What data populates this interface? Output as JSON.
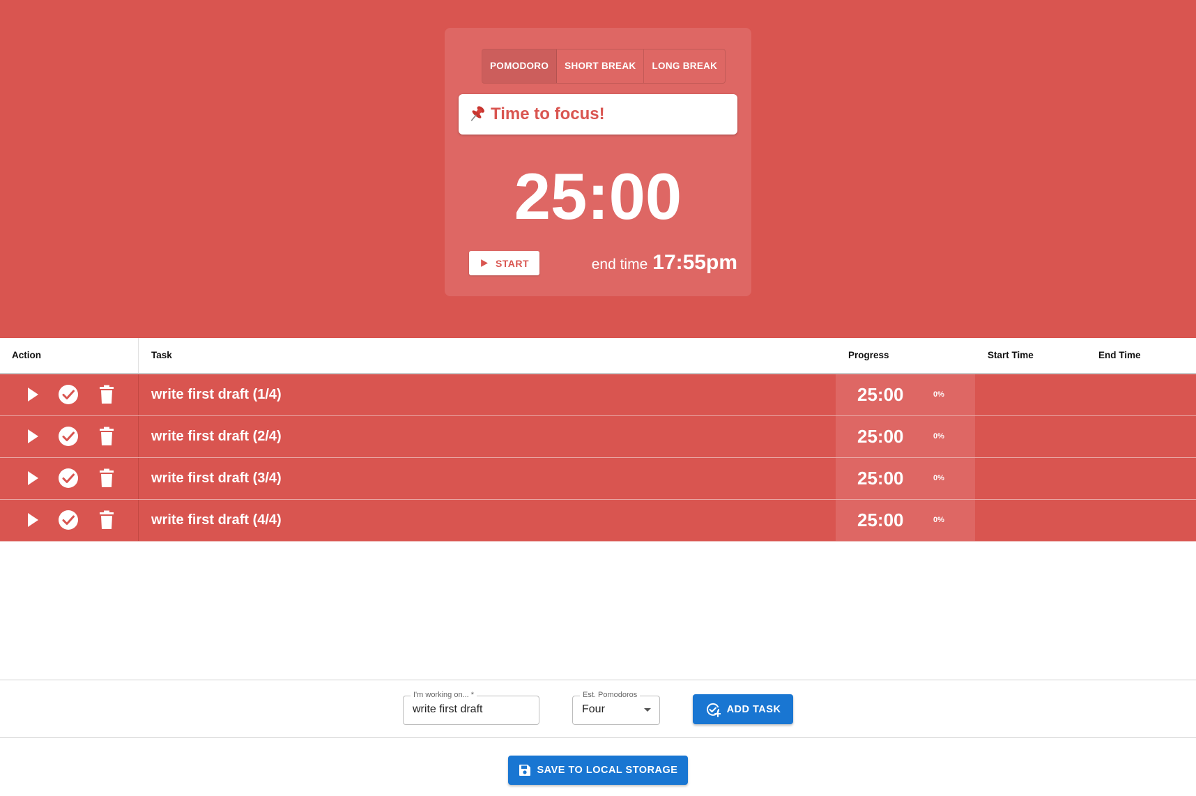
{
  "timer_card": {
    "modes": [
      {
        "label": "POMODORO",
        "active": true
      },
      {
        "label": "SHORT BREAK",
        "active": false
      },
      {
        "label": "LONG BREAK",
        "active": false
      }
    ],
    "focus_message": "Time to focus!",
    "time": "25:00",
    "start_label": "START",
    "end_time_label": "end time",
    "end_time_value": "17:55pm"
  },
  "table": {
    "headers": {
      "action": "Action",
      "task": "Task",
      "progress": "Progress",
      "start_time": "Start Time",
      "end_time": "End Time"
    },
    "rows": [
      {
        "task": "write first draft (1/4)",
        "time": "25:00",
        "percent": "0%"
      },
      {
        "task": "write first draft (2/4)",
        "time": "25:00",
        "percent": "0%"
      },
      {
        "task": "write first draft (3/4)",
        "time": "25:00",
        "percent": "0%"
      },
      {
        "task": "write first draft (4/4)",
        "time": "25:00",
        "percent": "0%"
      }
    ]
  },
  "form": {
    "task_label": "I'm working on... *",
    "task_value": "write first draft",
    "est_label": "Est. Pomodoros",
    "est_value": "Four",
    "add_label": "ADD TASK"
  },
  "save_label": "SAVE TO LOCAL STORAGE",
  "colors": {
    "theme_red": "#d95550",
    "card_red": "#de6764",
    "primary_blue": "#1976d2"
  }
}
